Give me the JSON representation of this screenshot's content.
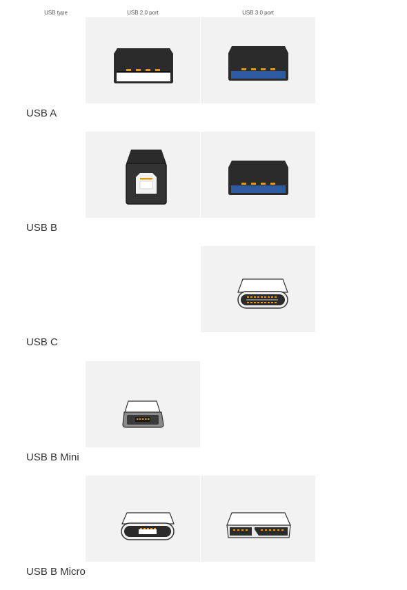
{
  "header": {
    "type_col": "USB type",
    "usb2_col": "USB 2.0 port",
    "usb3_col": "USB 3.0 port"
  },
  "rows": [
    {
      "label": "USB A",
      "usb2": {
        "icon": "usb-a-2-0-connector-icon"
      },
      "usb3": {
        "icon": "usb-a-3-0-connector-icon"
      }
    },
    {
      "label": "USB B",
      "usb2": {
        "icon": "usb-b-2-0-connector-icon"
      },
      "usb3": {
        "icon": "usb-a-3-0-connector-icon"
      }
    },
    {
      "label": "USB C",
      "usb2": null,
      "usb3": {
        "icon": "usb-c-connector-icon"
      }
    },
    {
      "label": "USB B Mini",
      "usb2": {
        "icon": "usb-mini-b-connector-icon"
      },
      "usb3": null
    },
    {
      "label": "USB B Micro",
      "usb2": {
        "icon": "usb-micro-b-connector-icon"
      },
      "usb3": {
        "icon": "usb-micro-b-3-0-connector-icon"
      }
    }
  ],
  "colors": {
    "tile_background": "#f2f2f2",
    "usb2_insert": "#ffffff",
    "usb3_insert": "#2d5aa0",
    "contact_pins": "#e8960c",
    "connector_body": "#2b2b2b"
  }
}
